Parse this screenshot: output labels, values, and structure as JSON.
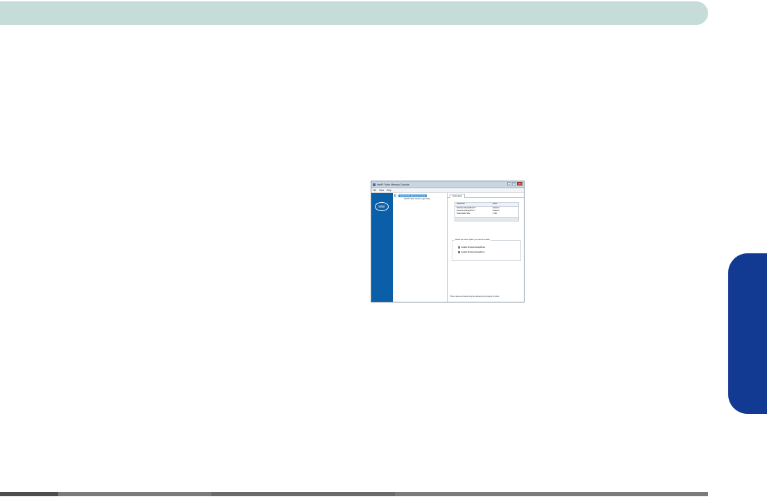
{
  "app": {
    "title": "Intel® Turbo Memory Console",
    "caption_min": "_",
    "caption_max": "□",
    "caption_close": "x"
  },
  "menu": [
    "File",
    "View",
    "Help"
  ],
  "brand": {
    "logo_text": "intel"
  },
  "tree": {
    "selected_label": "Intel® Turbo Memory Console",
    "child_label": "Intel® Flash Cache Logic Chip"
  },
  "tabs": [
    "Information"
  ],
  "grid": {
    "headers": [
      "Parameter",
      "Value"
    ],
    "rows": [
      [
        "Windows ReadyBoost™",
        "Enabled"
      ],
      [
        "Windows ReadyDrive™",
        "Enabled"
      ],
      [
        "Total Cache Size",
        "1 GB"
      ]
    ]
  },
  "group": {
    "label": "Select the cache option you want to enable:",
    "options": [
      {
        "label": "Enable Windows ReadyBoost",
        "checked": "✓"
      },
      {
        "label": "Enable Windows ReadyDrive",
        "checked": "✓"
      }
    ]
  },
  "footnote": "*Other names and brands may be claimed as the property of others.",
  "colors": {
    "banner": "#c5dcd8",
    "side_tab": "#123a92",
    "brand_panel": "#0a5fa8",
    "selection": "#3a8fd8"
  }
}
